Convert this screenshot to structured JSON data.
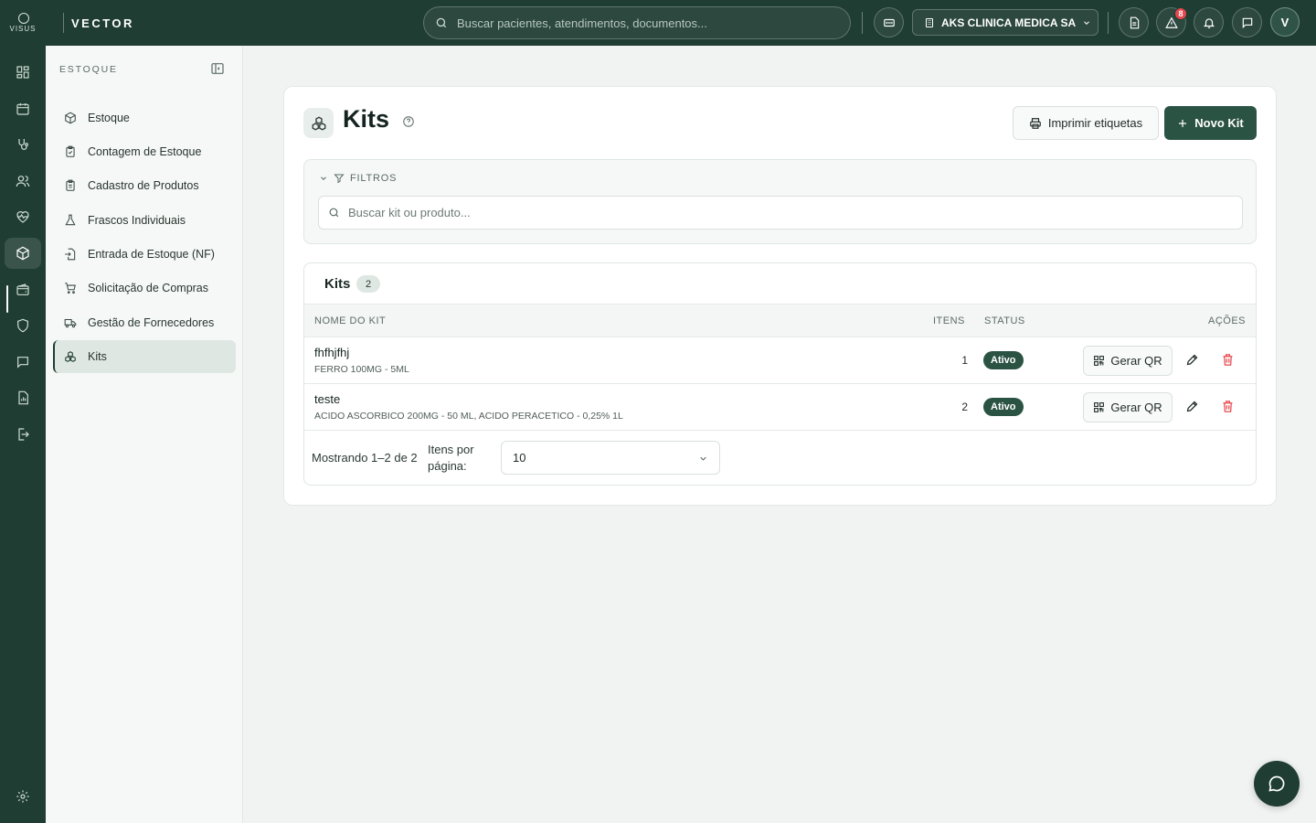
{
  "topbar": {
    "logo_text": "VISUS",
    "brand": "VECTOR",
    "search_placeholder": "Buscar pacientes, atendimentos, documentos...",
    "clinic_name": "AKS CLINICA MEDICA SA",
    "alerts_count": "8",
    "avatar_initial": "V"
  },
  "sidebar": {
    "title": "ESTOQUE",
    "items": [
      {
        "label": "Estoque"
      },
      {
        "label": "Contagem de Estoque"
      },
      {
        "label": "Cadastro de Produtos"
      },
      {
        "label": "Frascos Individuais"
      },
      {
        "label": "Entrada de Estoque (NF)"
      },
      {
        "label": "Solicitação de Compras"
      },
      {
        "label": "Gestão de Fornecedores"
      },
      {
        "label": "Kits"
      }
    ]
  },
  "page": {
    "title": "Kits",
    "print_label": "Imprimir etiquetas",
    "new_label": "Novo Kit"
  },
  "filters": {
    "label": "FILTROS",
    "search_placeholder": "Buscar kit ou produto..."
  },
  "table": {
    "title": "Kits",
    "count": "2",
    "headers": {
      "name": "NOME DO KIT",
      "items": "ITENS",
      "status": "STATUS",
      "actions": "AÇÕES"
    },
    "rows": [
      {
        "name": "fhfhjfhj",
        "products": "FERRO 100MG - 5ML",
        "items": "1",
        "status": "Ativo",
        "qr_label": "Gerar QR"
      },
      {
        "name": "teste",
        "products": "ACIDO ASCORBICO 200MG - 50 ML, ACIDO PERACETICO - 0,25% 1L",
        "items": "2",
        "status": "Ativo",
        "qr_label": "Gerar QR"
      }
    ]
  },
  "pager": {
    "showing": "Mostrando 1–2 de 2",
    "per_page_label": "Itens por página:",
    "per_page_value": "10"
  },
  "colors": {
    "primary": "#1f3d33",
    "accent": "#2b5344",
    "danger": "#e5484d"
  }
}
